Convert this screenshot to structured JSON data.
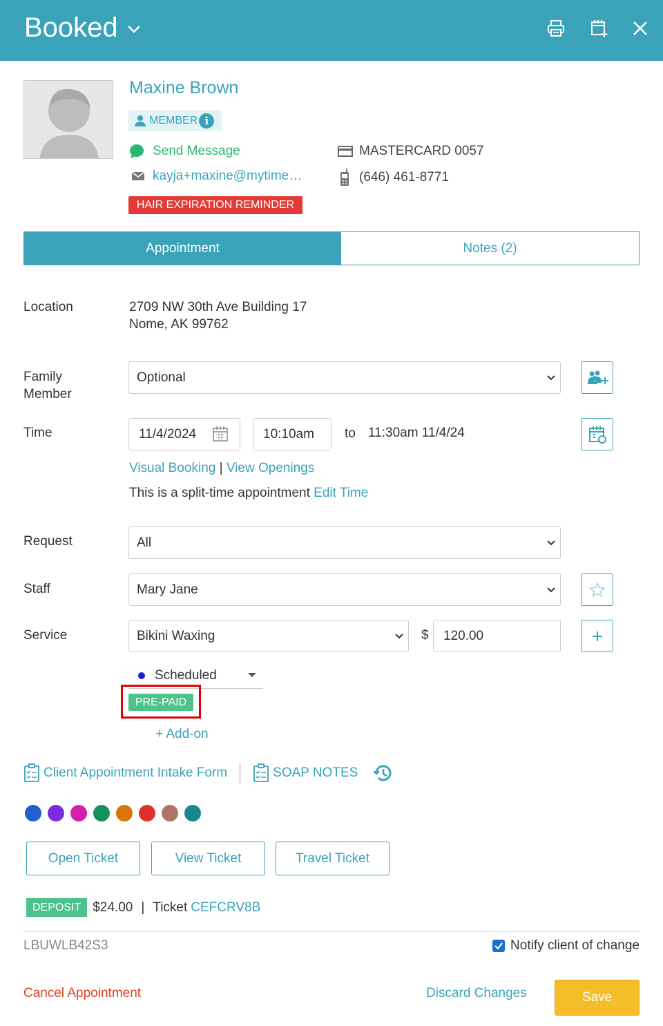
{
  "header": {
    "title": "Booked",
    "icons": [
      "chevron-down-icon",
      "printer-icon",
      "calendar-add-icon",
      "close-icon"
    ]
  },
  "client": {
    "name": "Maxine Brown",
    "member_label": "MEMBER",
    "send_message": "Send Message",
    "email": "kayja+maxine@mytime…",
    "card": "MASTERCARD 0057",
    "phone": "(646) 461-8771",
    "reminder": "HAIR EXPIRATION REMINDER"
  },
  "tabs": [
    {
      "label": "Appointment",
      "active": true
    },
    {
      "label": "Notes (2)",
      "active": false
    }
  ],
  "location": {
    "label": "Location",
    "line1": "2709 NW 30th Ave Building 17",
    "line2": "Nome, AK 99762"
  },
  "family_member": {
    "label_line1": "Family",
    "label_line2": "Member",
    "value": "Optional"
  },
  "time": {
    "label": "Time",
    "date": "11/4/2024",
    "start": "10:10am",
    "to": "to",
    "end": "11:30am 11/4/24",
    "visual_booking": "Visual Booking",
    "separator": "|",
    "view_openings": "View Openings",
    "split_text": "This is a split-time appointment",
    "edit_time": "Edit Time"
  },
  "request": {
    "label": "Request",
    "value": "All"
  },
  "staff": {
    "label": "Staff",
    "value": "Mary Jane"
  },
  "service": {
    "label": "Service",
    "value": "Bikini Waxing",
    "currency": "$",
    "price": "120.00",
    "status": "Scheduled",
    "prepaid": "PRE-PAID",
    "addon": "+ Add-on"
  },
  "forms": {
    "intake": "Client Appointment Intake Form",
    "soap": "SOAP NOTES"
  },
  "colors": [
    "#1f5fcf",
    "#7b2be0",
    "#d41fa8",
    "#17915a",
    "#d9740f",
    "#e12e2e",
    "#b07467",
    "#17878f"
  ],
  "accent": "#3aa3b9",
  "tickets": {
    "open": "Open Ticket",
    "view": "View Ticket",
    "travel": "Travel Ticket"
  },
  "deposit": {
    "badge": "DEPOSIT",
    "amount": "$24.00",
    "separator": "|",
    "ticket_label": "Ticket",
    "ticket_code": "CEFCRV8B"
  },
  "footer": {
    "code": "LBUWLB42S3",
    "notify": "Notify client of change",
    "notify_checked": true,
    "cancel": "Cancel Appointment",
    "discard": "Discard Changes",
    "save": "Save"
  }
}
